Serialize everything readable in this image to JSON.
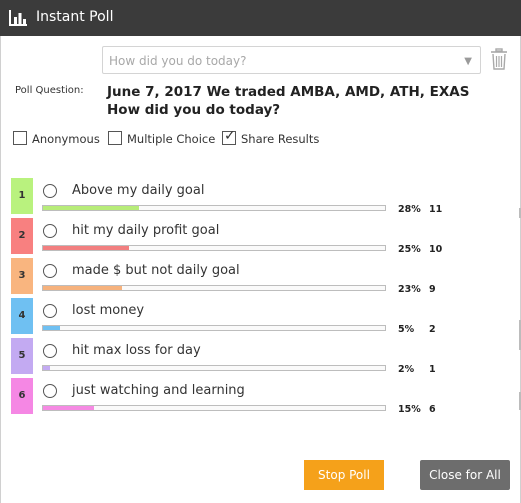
{
  "window": {
    "title": "Instant Poll",
    "title_icon": "bar-chart-icon"
  },
  "question_select": {
    "placeholder": "How did you do today?",
    "caret_icon": "chevron-down-icon"
  },
  "poll": {
    "question_label": "Poll Question:",
    "question_text": "June 7, 2017 We traded AMBA, AMD, ATH, EXAS How did you do today?"
  },
  "options": {
    "anonymous": {
      "label": "Anonymous",
      "checked": false
    },
    "multiple_choice": {
      "label": "Multiple Choice",
      "checked": false
    },
    "share_results": {
      "label": "Share Results",
      "checked": true
    }
  },
  "choices": [
    {
      "num": "1",
      "label": "Above my daily goal",
      "percent_text": "28%",
      "percent": 28,
      "count": "11",
      "badge_color": "#b9f27e",
      "bar_color": "#b7ec79"
    },
    {
      "num": "2",
      "label": "hit my daily profit goal",
      "percent_text": "25%",
      "percent": 25,
      "count": "10",
      "badge_color": "#f88080",
      "bar_color": "#f27f80"
    },
    {
      "num": "3",
      "label": "made $ but not daily goal",
      "percent_text": "23%",
      "percent": 23,
      "count": "9",
      "badge_color": "#f9b57f",
      "bar_color": "#f6b27d"
    },
    {
      "num": "4",
      "label": "lost money",
      "percent_text": "5%",
      "percent": 5,
      "count": "2",
      "badge_color": "#6fc0f2",
      "bar_color": "#6fc0f2"
    },
    {
      "num": "5",
      "label": "hit max loss for day",
      "percent_text": "2%",
      "percent": 2,
      "count": "1",
      "badge_color": "#c3aaf2",
      "bar_color": "#c3aaf2"
    },
    {
      "num": "6",
      "label": "just watching and learning",
      "percent_text": "15%",
      "percent": 15,
      "count": "6",
      "badge_color": "#f587e4",
      "bar_color": "#f58ae3"
    }
  ],
  "buttons": {
    "stop_poll": "Stop Poll",
    "close_for_all": "Close for All"
  },
  "colors": {
    "titlebar": "#3b3b3b",
    "stop_button": "#f5a11a",
    "close_button": "#6d6d6d"
  }
}
